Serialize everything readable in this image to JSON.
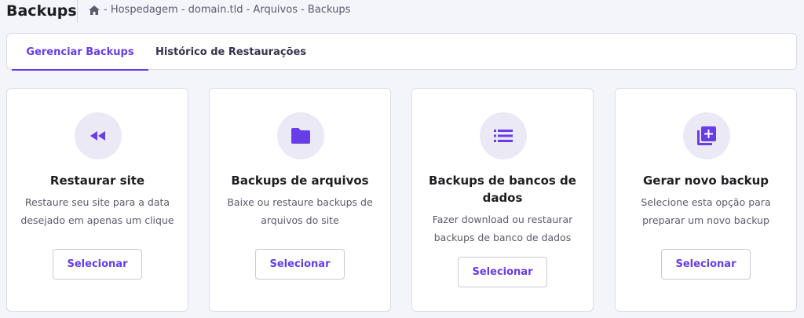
{
  "header": {
    "title": "Backups",
    "breadcrumb": [
      "- Hospedagem",
      "- domain.tld",
      "- Arquivos",
      "- Backups"
    ]
  },
  "tabs": [
    {
      "label": "Gerenciar Backups",
      "active": true
    },
    {
      "label": "Histórico de Restaurações",
      "active": false
    }
  ],
  "cards": [
    {
      "icon": "rewind-icon",
      "title": "Restaurar site",
      "description": "Restaure seu site para a data desejado em apenas um clique",
      "button": "Selecionar"
    },
    {
      "icon": "folder-icon",
      "title": "Backups de arquivos",
      "description": "Baixe ou restaure backups de arquivos do site",
      "button": "Selecionar"
    },
    {
      "icon": "list-icon",
      "title": "Backups de bancos de dados",
      "description": "Fazer download ou restaurar backups de banco de dados",
      "button": "Selecionar"
    },
    {
      "icon": "add-library-icon",
      "title": "Gerar novo backup",
      "description": "Selecione esta opção para preparar um novo backup",
      "button": "Selecionar"
    }
  ],
  "colors": {
    "accent": "#673de6",
    "icon_bg": "#ebe9f5",
    "background": "#f4f4fb"
  }
}
